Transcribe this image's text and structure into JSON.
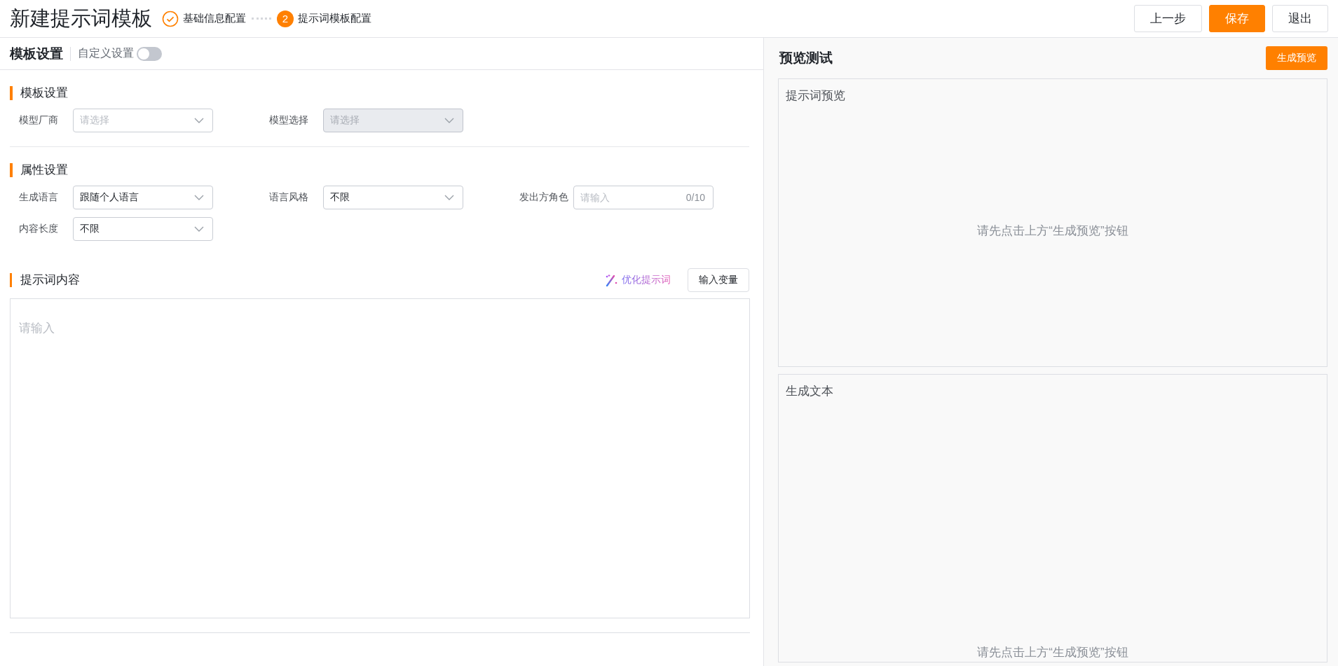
{
  "header": {
    "title": "新建提示词模板",
    "steps": [
      {
        "label": "基础信息配置",
        "completed": true,
        "selected": false
      },
      {
        "number": "2",
        "label": "提示词模板配置",
        "completed": false,
        "selected": true
      }
    ],
    "buttons": [
      {
        "label": "上一步",
        "kind": "default"
      },
      {
        "label": "保存",
        "kind": "primary"
      },
      {
        "label": "退出",
        "kind": "default"
      }
    ]
  },
  "template": {
    "title": "模板设置",
    "custom_setting": {
      "label": "自定义设置",
      "on": false
    },
    "sections": [
      {
        "title": "模板设置",
        "fields": [
          {
            "label": "模型厂商",
            "kind": "select",
            "placeholder": "请选择",
            "disabled": false
          },
          {
            "label": "模型选择",
            "kind": "select",
            "placeholder": "请选择",
            "disabled": true
          }
        ]
      },
      {
        "title": "属性设置",
        "fields": [
          {
            "label": "生成语言",
            "kind": "select",
            "value": "跟随个人语言",
            "disabled": false
          },
          {
            "label": "语言风格",
            "kind": "select",
            "value": "不限",
            "disabled": false
          },
          {
            "label": "发出方角色",
            "kind": "input",
            "placeholder": "请输入",
            "counter": "0/10",
            "disabled": false
          },
          {
            "label": "内容长度",
            "kind": "select",
            "value": "不限",
            "disabled": false
          }
        ]
      }
    ],
    "prompt": {
      "title": "提示词内容",
      "optimize_link": "优化提示词",
      "variable_button": "输入变量",
      "placeholder": "请输入"
    }
  },
  "preview": {
    "title": "预览测试",
    "button": "生成预览",
    "panels": [
      {
        "title": "提示词预览",
        "empty_text": "请先点击上方“生成预览”按钮"
      },
      {
        "title": "生成文本",
        "empty_text": "请先点击上方“生成预览”按钮"
      }
    ]
  }
}
